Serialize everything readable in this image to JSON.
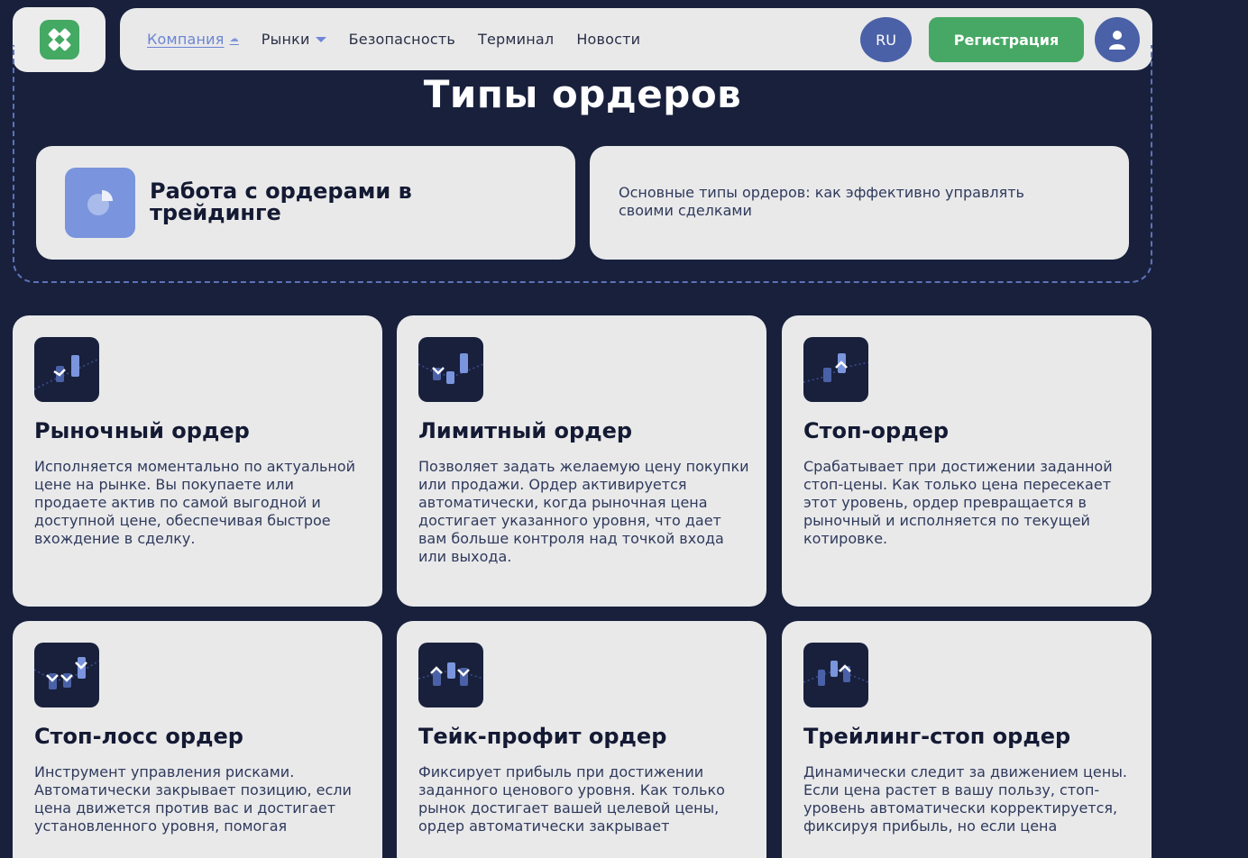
{
  "header": {
    "nav": [
      {
        "label": "Компания"
      },
      {
        "label": "Рынки"
      },
      {
        "label": "Безопасность"
      },
      {
        "label": "Терминал"
      },
      {
        "label": "Новости"
      }
    ],
    "lang": "RU",
    "register_label": "Регистрация"
  },
  "hero": {
    "title": "Типы ордеров",
    "card_title": "Работа с ордерами в трейдинге",
    "card_text": "Основные типы ордеров: как эффективно управлять своими сделками"
  },
  "orders": [
    {
      "title": "Рыночный ордер",
      "text": "Исполняется моментально по актуальной цене на рынке. Вы покупаете или продаете актив по самой выгодной и доступной цене, обеспечивая быстрое вхождение в сделку."
    },
    {
      "title": "Лимитный ордер",
      "text": "Позволяет задать желаемую цену покупки или продажи. Ордер активируется автоматически, когда рыночная цена достигает указанного уровня, что дает вам больше контроля над точкой входа или выхода."
    },
    {
      "title": "Стоп-ордер",
      "text": "Срабатывает при достижении заданной стоп-цены. Как только цена пересекает этот уровень, ордер превращается в рыночный и исполняется по текущей котировке."
    },
    {
      "title": "Стоп-лосс ордер",
      "text": "Инструмент управления рисками. Автоматически закрывает позицию, если цена движется против вас и достигает установленного уровня, помогая"
    },
    {
      "title": "Тейк-профит ордер",
      "text": "Фиксирует прибыль при достижении заданного ценового уровня. Как только рынок достигает вашей целевой цены, ордер автоматически закрывает"
    },
    {
      "title": "Трейлинг-стоп ордер",
      "text": "Динамически следит за движением цены. Если цена растет в вашу пользу, стоп-уровень автоматически корректируется, фиксируя прибыль, но если цена"
    }
  ],
  "colors": {
    "background": "#18203c",
    "card": "#e9e9ea",
    "accent_blue": "#4a61a7",
    "accent_green": "#46a864",
    "icon_blue": "#7a95dd"
  }
}
